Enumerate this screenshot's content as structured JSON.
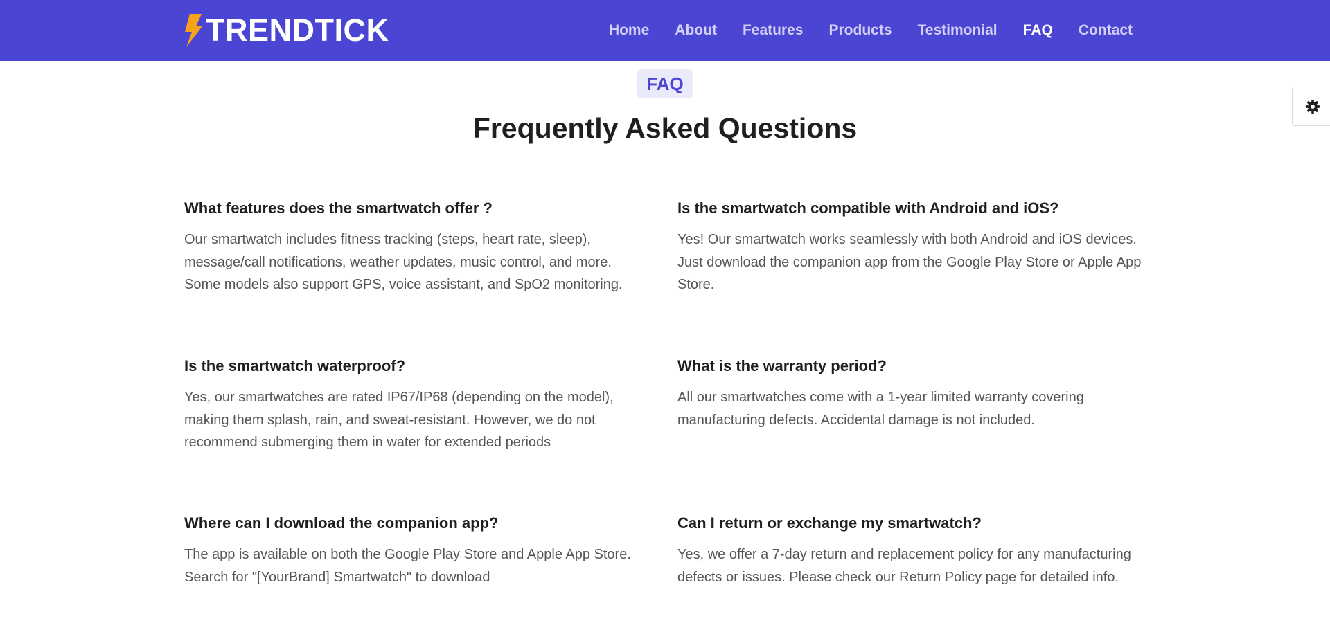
{
  "brand": {
    "name": "TRENDTICK",
    "icon": "lightning-bolt-icon",
    "icon_color": "#f7a21b"
  },
  "nav": {
    "items": [
      {
        "label": "Home",
        "active": false
      },
      {
        "label": "About",
        "active": false
      },
      {
        "label": "Features",
        "active": false
      },
      {
        "label": "Products",
        "active": false
      },
      {
        "label": "Testimonial",
        "active": false
      },
      {
        "label": "FAQ",
        "active": true
      },
      {
        "label": "Contact",
        "active": false
      }
    ]
  },
  "settings": {
    "icon": "gear-icon"
  },
  "section": {
    "badge": "FAQ",
    "title": "Frequently Asked Questions"
  },
  "faqs": [
    {
      "question": "What features does the smartwatch offer ?",
      "answer": "Our smartwatch includes fitness tracking (steps, heart rate, sleep), message/call notifications, weather updates, music control, and more. Some models also support GPS, voice assistant, and SpO2 monitoring."
    },
    {
      "question": "Is the smartwatch compatible with Android and iOS?",
      "answer": "Yes! Our smartwatch works seamlessly with both Android and iOS devices. Just download the companion app from the Google Play Store or Apple App Store."
    },
    {
      "question": "Is the smartwatch waterproof?",
      "answer": "Yes, our smartwatches are rated IP67/IP68 (depending on the model), making them splash, rain, and sweat-resistant. However, we do not recommend submerging them in water for extended periods"
    },
    {
      "question": "What is the warranty period?",
      "answer": "All our smartwatches come with a 1-year limited warranty covering manufacturing defects. Accidental damage is not included."
    },
    {
      "question": "Where can I download the companion app?",
      "answer": "The app is available on both the Google Play Store and Apple App Store. Search for \"[YourBrand] Smartwatch\" to download"
    },
    {
      "question": "Can I return or exchange my smartwatch?",
      "answer": "Yes, we offer a 7-day return and replacement policy for any manufacturing defects or issues. Please check our Return Policy page for detailed info."
    }
  ],
  "colors": {
    "navbar_bg": "#4a46d3",
    "accent": "#4a46d3",
    "badge_bg": "#ebeafb",
    "nav_link": "#d3d0f8",
    "nav_link_active": "#ffffff"
  }
}
